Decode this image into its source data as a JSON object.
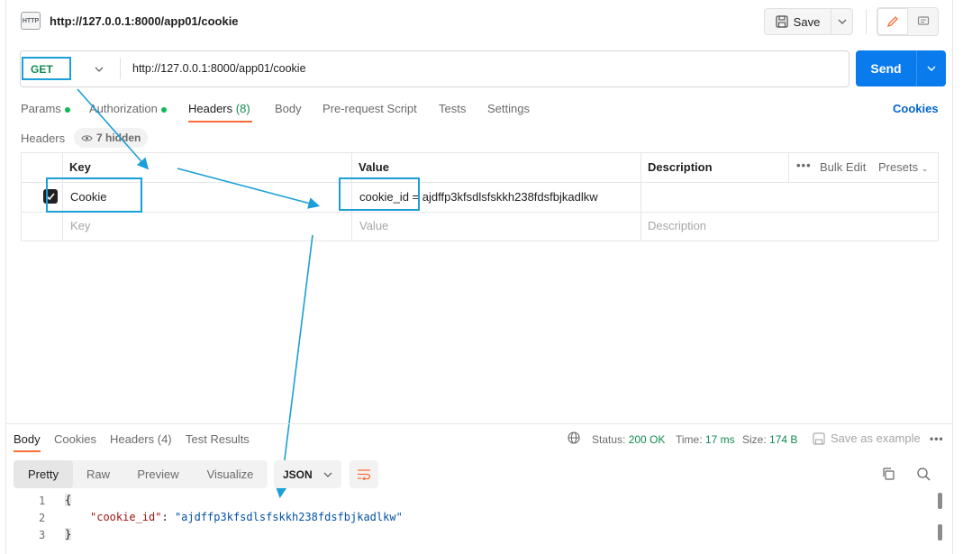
{
  "request": {
    "badge": "HTTP",
    "title": "http://127.0.0.1:8000/app01/cookie",
    "save_label": "Save",
    "method": "GET",
    "url": "http://127.0.0.1:8000/app01/cookie",
    "send_label": "Send"
  },
  "tabs": {
    "params": "Params",
    "authorization": "Authorization",
    "headers": "Headers",
    "headers_count": "(8)",
    "body": "Body",
    "prerequest": "Pre-request Script",
    "tests": "Tests",
    "settings": "Settings",
    "cookies": "Cookies"
  },
  "headers_section": {
    "label": "Headers",
    "hidden": "7 hidden"
  },
  "table": {
    "col_key": "Key",
    "col_value": "Value",
    "col_description": "Description",
    "bulk_edit": "Bulk Edit",
    "presets": "Presets",
    "row_key": "Cookie",
    "row_value": "cookie_id = ajdffp3kfsdlsfskkh238fdsfbjkadlkw",
    "ph_key": "Key",
    "ph_value": "Value",
    "ph_description": "Description"
  },
  "response": {
    "tab_body": "Body",
    "tab_cookies": "Cookies",
    "tab_headers": "Headers (4)",
    "tab_tests": "Test Results",
    "status_label": "Status:",
    "status_value": "200 OK",
    "time_label": "Time:",
    "time_value": "17 ms",
    "size_label": "Size:",
    "size_value": "174 B",
    "save_example": "Save as example",
    "view_pretty": "Pretty",
    "view_raw": "Raw",
    "view_preview": "Preview",
    "view_visualize": "Visualize",
    "format": "JSON",
    "lines": [
      "1",
      "2",
      "3"
    ],
    "open_brace": "{",
    "json_key": "\"cookie_id\"",
    "json_colon": ": ",
    "json_value": "\"ajdffp3kfsdlsfskkh238fdsfbjkadlkw\"",
    "close_brace": "}"
  },
  "colors": {
    "accent_orange": "#ff6c37",
    "send_blue": "#097bed",
    "method_green": "#0f8a52",
    "annotation_blue": "#1b9fd9"
  }
}
